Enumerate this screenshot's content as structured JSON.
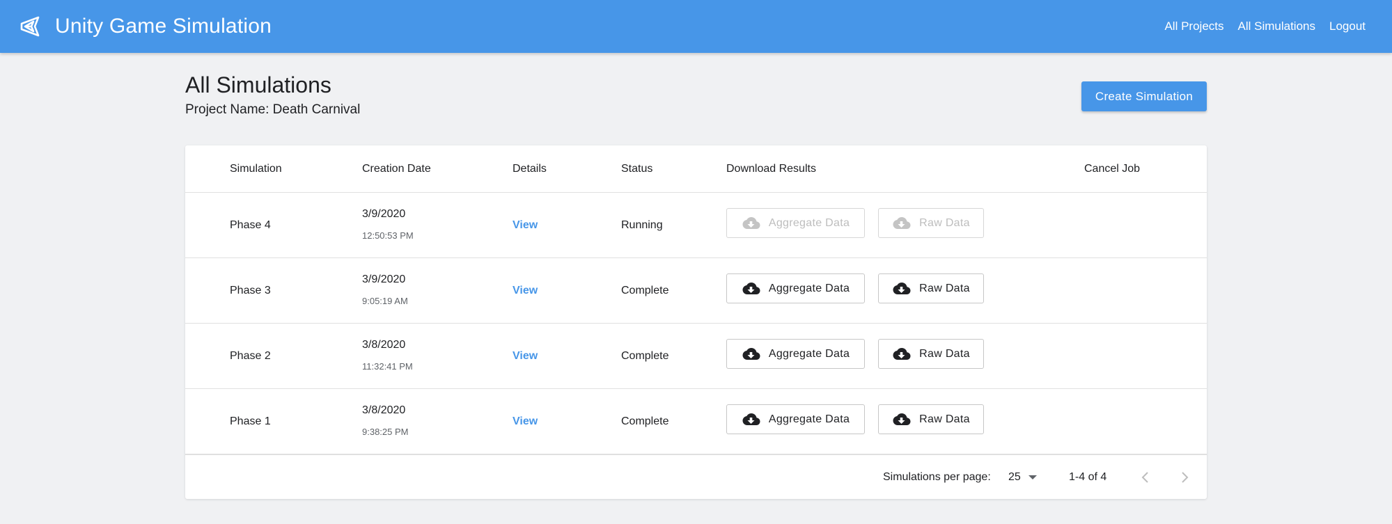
{
  "app": {
    "title": "Unity Game Simulation",
    "logo_icon": "unity-logo-icon"
  },
  "nav": [
    {
      "label": "All Projects"
    },
    {
      "label": "All Simulations"
    },
    {
      "label": "Logout"
    }
  ],
  "page": {
    "title": "All Simulations",
    "project_line": "Project Name: Death Carnival",
    "create_button": "Create Simulation"
  },
  "table": {
    "columns": [
      "Simulation",
      "Creation Date",
      "Details",
      "Status",
      "Download Results",
      "Cancel Job"
    ],
    "rows": [
      {
        "name": "Phase 4",
        "date": "3/9/2020",
        "time": "12:50:53 PM",
        "details": "View",
        "status": "Running",
        "aggregate": "Aggregate Data",
        "raw": "Raw Data",
        "downloads_enabled": false
      },
      {
        "name": "Phase 3",
        "date": "3/9/2020",
        "time": "9:05:19 AM",
        "details": "View",
        "status": "Complete",
        "aggregate": "Aggregate Data",
        "raw": "Raw Data",
        "downloads_enabled": true
      },
      {
        "name": "Phase 2",
        "date": "3/8/2020",
        "time": "11:32:41 PM",
        "details": "View",
        "status": "Complete",
        "aggregate": "Aggregate Data",
        "raw": "Raw Data",
        "downloads_enabled": true
      },
      {
        "name": "Phase 1",
        "date": "3/8/2020",
        "time": "9:38:25 PM",
        "details": "View",
        "status": "Complete",
        "aggregate": "Aggregate Data",
        "raw": "Raw Data",
        "downloads_enabled": true
      }
    ]
  },
  "pagination": {
    "per_page_label": "Simulations per page:",
    "per_page_value": "25",
    "range": "1-4 of 4"
  },
  "colors": {
    "primary": "#4796e8",
    "background": "#f0f1f3",
    "disabled": "#bdbdbd"
  }
}
